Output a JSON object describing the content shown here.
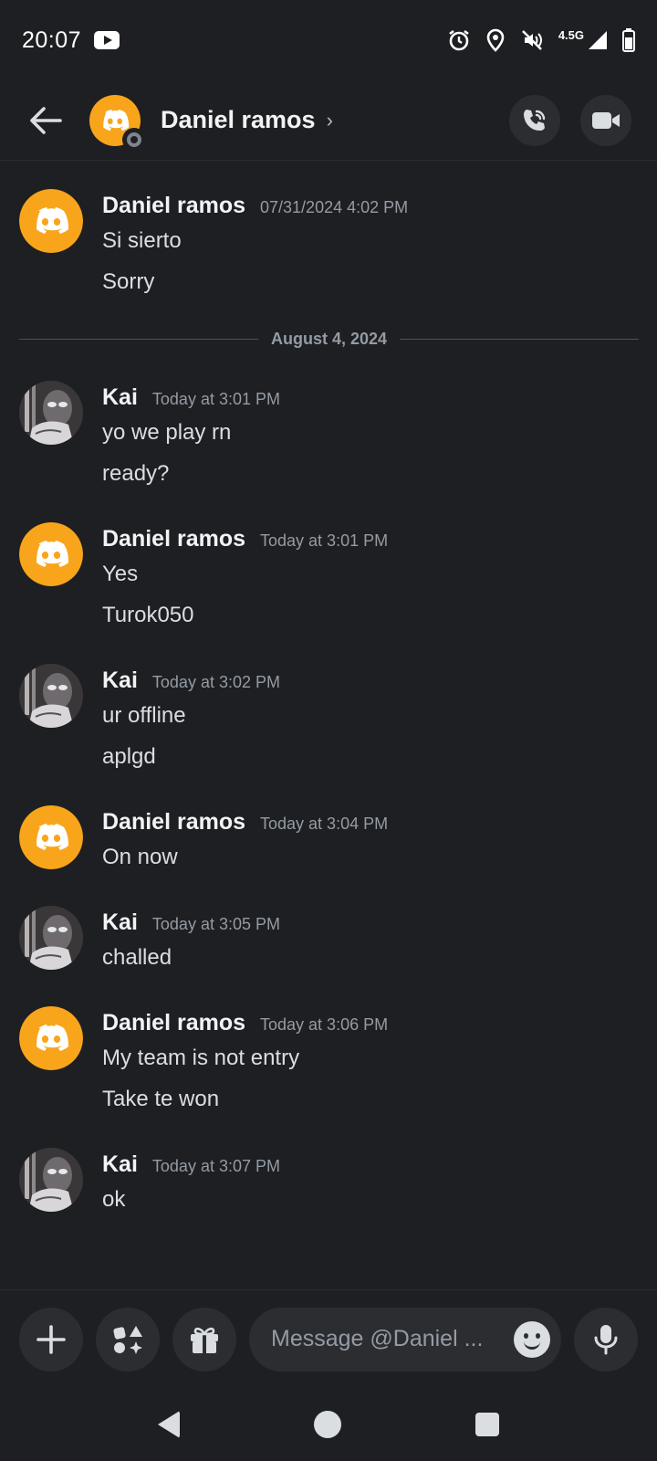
{
  "status_bar": {
    "time": "20:07",
    "network": "4.5G",
    "icons": [
      "youtube-icon",
      "alarm-icon",
      "location-icon",
      "mute-icon",
      "signal-icon",
      "battery-icon"
    ]
  },
  "header": {
    "back_icon": "arrow-left-icon",
    "title": "Daniel ramos",
    "chevron": "›",
    "call_icon": "phone-call-icon",
    "video_icon": "video-camera-icon"
  },
  "colors": {
    "background": "#1e1f22",
    "discord_orange": "#f8a51b",
    "surface": "#2b2d31",
    "muted_text": "#949ba4"
  },
  "date_divider": "August 4, 2024",
  "messages": [
    {
      "author": "Daniel ramos",
      "timestamp": "07/31/2024 4:02 PM",
      "avatar": "discord-orange",
      "lines": [
        "Si sierto",
        "Sorry"
      ]
    },
    {
      "author": "Kai",
      "timestamp": "Today at 3:01 PM",
      "avatar": "kai-photo",
      "lines": [
        "yo we play rn",
        "ready?"
      ]
    },
    {
      "author": "Daniel ramos",
      "timestamp": "Today at 3:01 PM",
      "avatar": "discord-orange",
      "lines": [
        "Yes",
        "Turok050"
      ]
    },
    {
      "author": "Kai",
      "timestamp": "Today at 3:02 PM",
      "avatar": "kai-photo",
      "lines": [
        "ur offline",
        "aplgd"
      ]
    },
    {
      "author": "Daniel ramos",
      "timestamp": "Today at 3:04 PM",
      "avatar": "discord-orange",
      "lines": [
        "On now"
      ]
    },
    {
      "author": "Kai",
      "timestamp": "Today at 3:05 PM",
      "avatar": "kai-photo",
      "lines": [
        "challed"
      ]
    },
    {
      "author": "Daniel ramos",
      "timestamp": "Today at 3:06 PM",
      "avatar": "discord-orange",
      "lines": [
        "My team is not entry",
        "Take te won"
      ]
    },
    {
      "author": "Kai",
      "timestamp": "Today at 3:07 PM",
      "avatar": "kai-photo",
      "lines": [
        "ok"
      ]
    }
  ],
  "composer": {
    "placeholder": "Message @Daniel ...",
    "buttons": [
      "plus-icon",
      "apps-icon",
      "gift-icon",
      "emoji-icon",
      "microphone-icon"
    ]
  },
  "nav_bar": [
    "back-triangle-icon",
    "home-circle-icon",
    "recents-square-icon"
  ]
}
